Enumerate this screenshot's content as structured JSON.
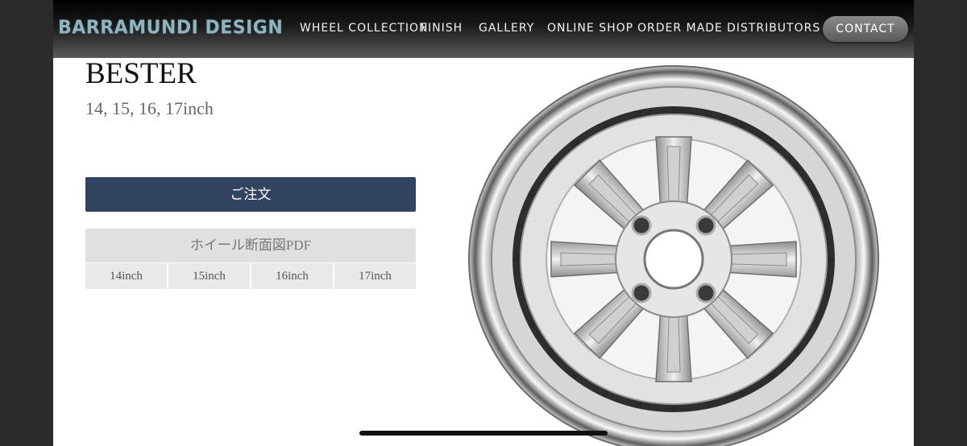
{
  "nav": {
    "logo": "BARRAMUNDI DESIGN",
    "items": [
      "WHEEL COLLECTION",
      "FINISH",
      "GALLERY",
      "ONLINE SHOP",
      "ORDER MADE",
      "DISTRIBUTORS"
    ],
    "contact": "CONTACT"
  },
  "product": {
    "name": "BESTER",
    "sizes": "14, 15, 16, 17inch",
    "order_label": "ご注文",
    "pdf_title": "ホイール断面図PDF",
    "pdf_sizes": [
      "14inch",
      "15inch",
      "16inch",
      "17inch"
    ],
    "image": "wheel-image"
  },
  "colors": {
    "order_button": "#324360",
    "logo": "#8fb4bd",
    "contact_button": "#6e6e6e"
  }
}
